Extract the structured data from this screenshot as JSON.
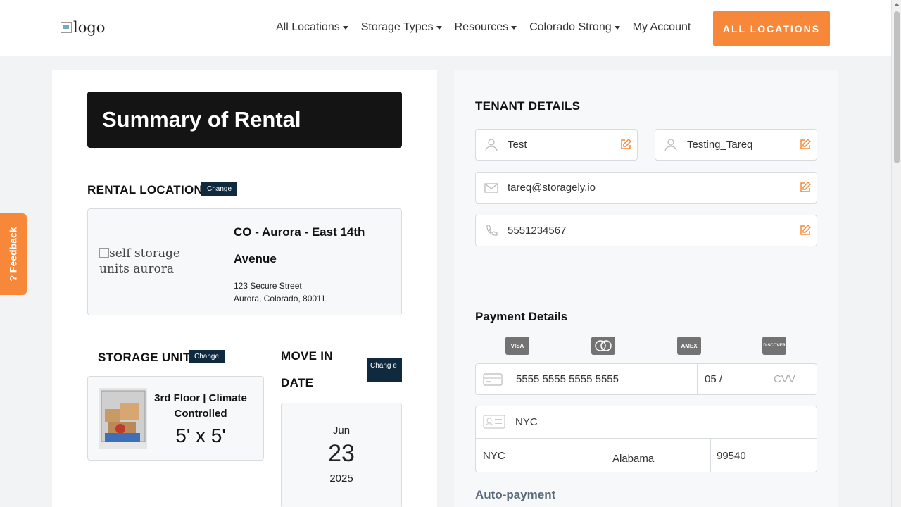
{
  "header": {
    "logo_alt": "logo",
    "nav": [
      {
        "label": "All Locations",
        "dropdown": true
      },
      {
        "label": "Storage Types",
        "dropdown": true
      },
      {
        "label": "Resources",
        "dropdown": true
      },
      {
        "label": "Colorado Strong",
        "dropdown": true
      },
      {
        "label": "My Account",
        "dropdown": false
      }
    ],
    "cta_label": "ALL LOCATIONS"
  },
  "feedback_label": "? Feedback",
  "summary": {
    "title": "Summary of Rental",
    "rental_location_label": "RENTAL LOCATION",
    "change_label": "Change",
    "location": {
      "image_alt": "self storage units aurora",
      "name": "CO - Aurora - East 14th Avenue",
      "address_line1": "123 Secure Street",
      "address_line2": "Aurora, Colorado, 80011"
    },
    "storage_unit_label": "STORAGE UNIT",
    "unit": {
      "type": "3rd Floor | Climate Controlled",
      "size": "5' x 5'"
    },
    "move_in_label": "MOVE IN DATE",
    "move_in_change_label": "Chang e",
    "move_in": {
      "month": "Jun",
      "day": "23",
      "year": "2025"
    }
  },
  "tenant": {
    "title": "TENANT DETAILS",
    "first_name": "Test",
    "last_name": "Testing_Tareq",
    "email": "tareq@storagely.io",
    "phone": "5551234567"
  },
  "payment": {
    "title": "Payment Details",
    "card_brands": [
      "VISA",
      "MC",
      "AMEX",
      "DISCOVER"
    ],
    "card_number": "5555 5555 5555 5555",
    "expiry": "05 /",
    "cvv_placeholder": "CVV",
    "name_on_card": "NYC",
    "city": "NYC",
    "state": "Alabama",
    "zip": "99540",
    "auto_payment_label": "Auto-payment"
  },
  "colors": {
    "accent": "#f7883a",
    "dark": "#141414",
    "navy": "#0f2a3f"
  }
}
